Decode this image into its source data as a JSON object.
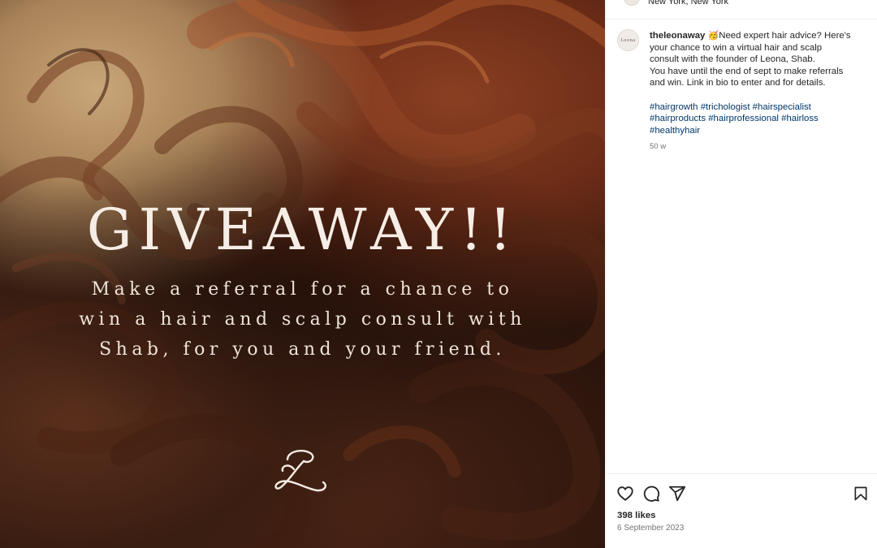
{
  "post": {
    "overlay": {
      "headline": "GIVEAWAY!!",
      "lines": [
        "Make a referral for a chance to",
        "win a hair and scalp consult with",
        "Shab, for you and your friend."
      ],
      "logo_letter": "L"
    }
  },
  "side": {
    "location": "New York, New York",
    "caption": {
      "avatar_text": "Leona",
      "username": "theleonaway",
      "emoji": "🥳",
      "text_line1": "Need expert hair advice? Here's",
      "text_line2": "your chance to win a virtual hair and scalp",
      "text_line3": "consult with the founder of Leona, Shab.",
      "text_line4": "You have until the end of sept to make referrals",
      "text_line5": "and win. Link in bio to enter and for details.",
      "hashtags_line1": [
        "#hairgrowth",
        "#trichologist",
        "#hairspecialist"
      ],
      "hashtags_line2": [
        "#hairproducts",
        "#hairprofessional",
        "#hairloss"
      ],
      "hashtags_line3": [
        "#healthyhair"
      ],
      "age": "50 w"
    },
    "actions": {
      "like_icon": "heart-icon",
      "comment_icon": "comment-icon",
      "share_icon": "send-icon",
      "save_icon": "bookmark-icon"
    },
    "likes": "398 likes",
    "date": "6 September 2023"
  }
}
